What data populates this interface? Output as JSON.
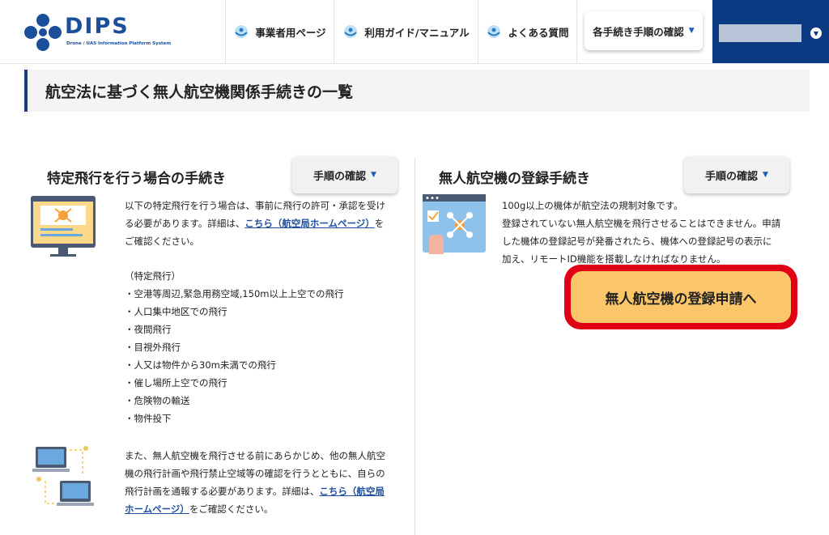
{
  "header": {
    "logo": {
      "text": "DIPS",
      "subtitle": "Drone / UAS Information Platform System"
    },
    "nav": [
      {
        "label": "事業者用ページ",
        "icon": "drone-globe-icon"
      },
      {
        "label": "利用ガイド/マニュアル",
        "icon": "drone-globe-icon"
      },
      {
        "label": "よくある質問",
        "icon": "drone-globe-icon"
      }
    ],
    "procedures_dropdown": {
      "label": "各手続き手順の確認",
      "caret": "▼"
    },
    "user_menu": {
      "toggle": "▼"
    }
  },
  "page": {
    "title": "航空法に基づく無人航空機関係手続きの一覧"
  },
  "left_section": {
    "title": "特定飛行を行う場合の手続き",
    "proc_button": "手順の確認",
    "caret": "▼",
    "intro_1": "以下の特定飛行を行う場合は、事前に飛行の許可・承認を受け",
    "intro_2a": "る必要があります。詳細は、",
    "intro_link": "こちら（航空局ホームページ）",
    "intro_2b": "を",
    "intro_3": "ご確認ください。",
    "list_heading": "（特定飛行）",
    "list_items": [
      "・空港等周辺,緊急用務空域,150m以上上空での飛行",
      "・人口集中地区での飛行",
      "・夜間飛行",
      "・目視外飛行",
      "・人又は物件から30m未満での飛行",
      "・催し場所上空での飛行",
      "・危険物の輸送",
      "・物件投下"
    ],
    "outro_1": "また、無人航空機を飛行させる前にあらかじめ、他の無人航空",
    "outro_2": "機の飛行計画や飛行禁止空域等の確認を行うとともに、自らの",
    "outro_3a": "飛行計画を通報する必要があります。詳細は、",
    "outro_link_1": "こちら（航空局",
    "outro_link_2": "ホームページ）",
    "outro_4": "をご確認ください。"
  },
  "right_section": {
    "title": "無人航空機の登録手続き",
    "proc_button": "手順の確認",
    "caret": "▼",
    "line_1": "100g以上の機体が航空法の規制対象です。",
    "line_2": "登録されていない無人航空機を飛行させることはできません。申請",
    "line_3": "した機体の登録記号が発番されたら、機体への登録記号の表示に",
    "line_4": "加え、リモートID機能を搭載しなければなりません。",
    "register_button": "無人航空機の登録申請へ"
  },
  "colors": {
    "brand_blue": "#1b4f9c",
    "user_bar": "#0c3a82",
    "highlight_red": "#e00016",
    "button_orange": "#fbc56a",
    "link": "#1f4fa0"
  }
}
